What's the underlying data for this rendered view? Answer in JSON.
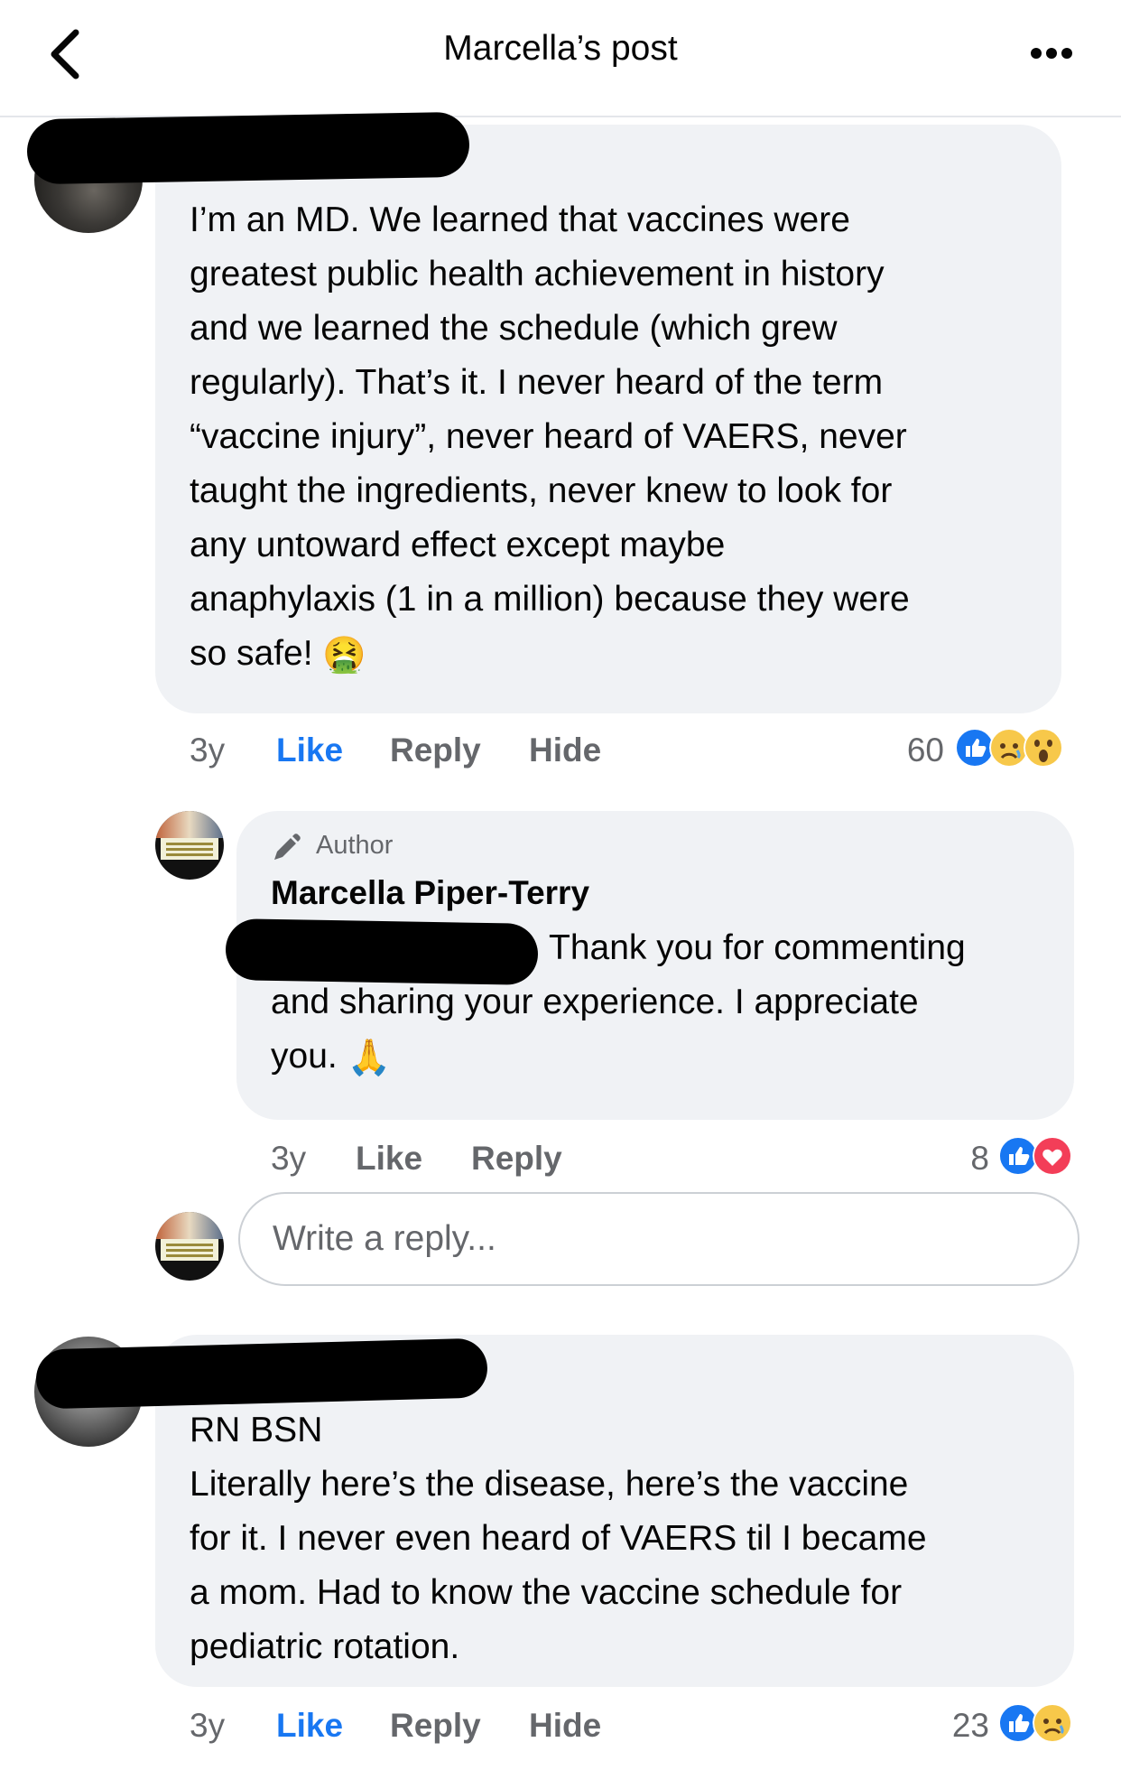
{
  "header": {
    "title": "Marcella’s post"
  },
  "comments": [
    {
      "text": "I’m an MD. We learned that vaccines were\ngreatest public health achievement in history\nand we learned the schedule (which grew\nregularly). That’s it. I never heard of the term\n“vaccine injury”, never heard of VAERS, never\ntaught the ingredients, never knew to look for\nany untoward effect except maybe\nanaphylaxis (1 in a million) because they were\nso safe!",
      "emoji": "🤮",
      "time": "3y",
      "like": "Like",
      "reply": "Reply",
      "hide": "Hide",
      "reaction_count": "60",
      "reactions": [
        "like-icon",
        "sad-icon",
        "wow-icon"
      ]
    },
    {
      "text": "RN BSN\nLiterally here’s the disease, here’s the vaccine\nfor it. I never even heard of VAERS til I became\na mom. Had to know the vaccine schedule for\npediatric rotation.",
      "time": "3y",
      "like": "Like",
      "reply": "Reply",
      "hide": "Hide",
      "reaction_count": "23",
      "reactions": [
        "like-icon",
        "sad-icon"
      ]
    }
  ],
  "author_reply": {
    "badge": "Author",
    "name": "Marcella Piper-Terry",
    "text_line1": "Thank you for commenting",
    "text_rest": "and sharing your experience. I appreciate\nyou.",
    "emoji": "🙏",
    "time": "3y",
    "like": "Like",
    "reply": "Reply",
    "reaction_count": "8",
    "reactions": [
      "like-icon",
      "love-icon"
    ]
  },
  "reply_box": {
    "placeholder": "Write a reply..."
  },
  "colors": {
    "like_blue": "#1877f2",
    "muted": "#65676b",
    "bubble": "#f0f2f5"
  }
}
